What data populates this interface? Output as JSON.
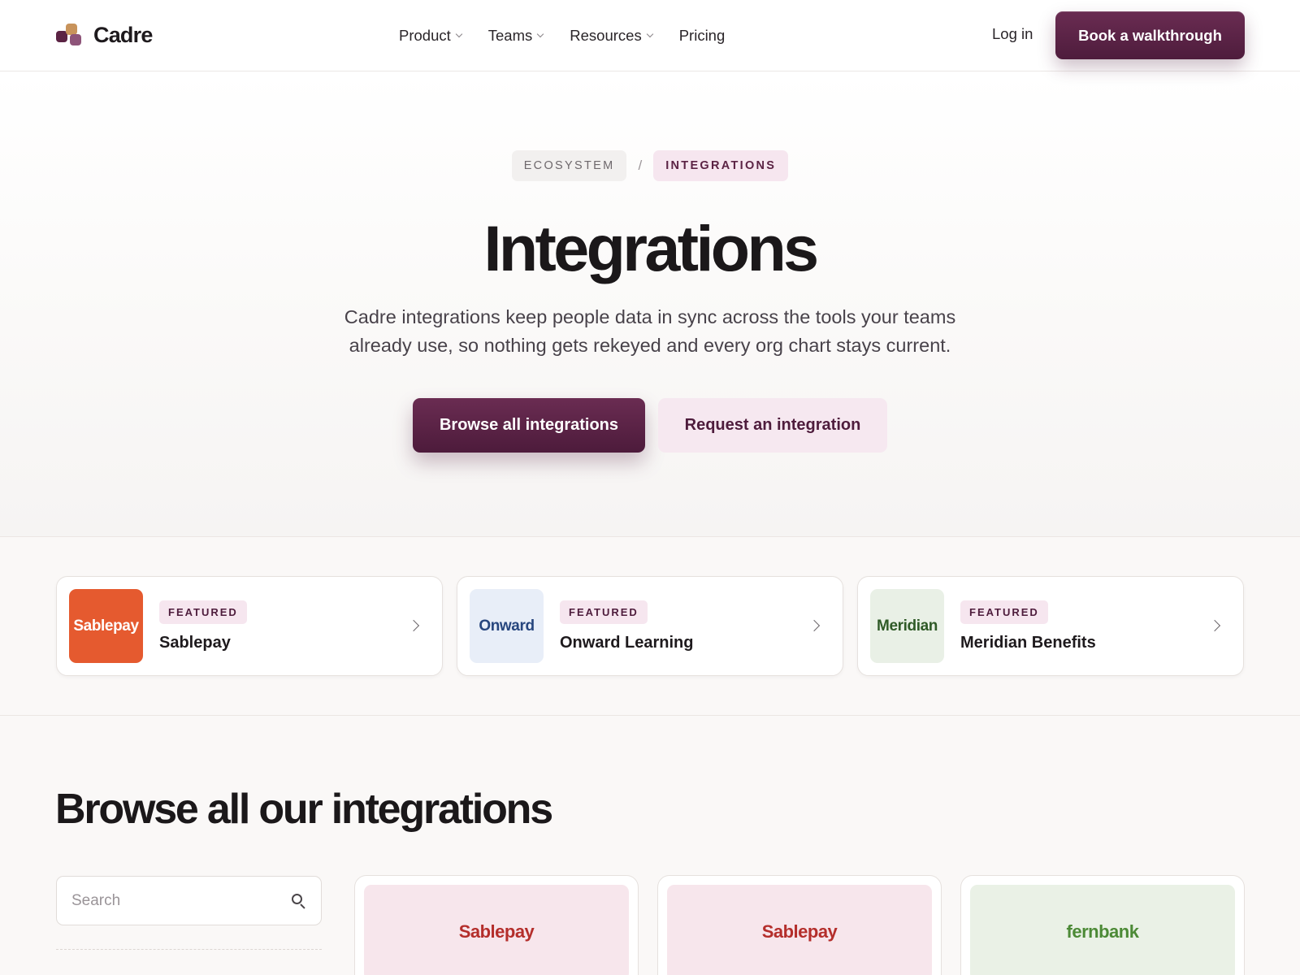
{
  "header": {
    "brand": "Cadre",
    "nav": [
      {
        "label": "Product",
        "has_dropdown": true
      },
      {
        "label": "Teams",
        "has_dropdown": true
      },
      {
        "label": "Resources",
        "has_dropdown": true
      },
      {
        "label": "Pricing",
        "has_dropdown": false
      }
    ],
    "login_label": "Log in",
    "cta_label": "Book a walkthrough"
  },
  "hero": {
    "breadcrumb": [
      "ECOSYSTEM",
      "INTEGRATIONS"
    ],
    "breadcrumb_separator": "/",
    "title": "Integrations",
    "subtitle": "Cadre integrations keep people data in sync across the tools your teams already use, so nothing gets rekeyed and every org chart stays current.",
    "primary_cta": "Browse all integrations",
    "secondary_cta": "Request an integration"
  },
  "featured": [
    {
      "logo_text": "Sablepay",
      "badge": "FEATURED",
      "name": "Sablepay",
      "logo_bg": "#e55a2f",
      "logo_color": "#ffffff"
    },
    {
      "logo_text": "Onward",
      "badge": "FEATURED",
      "name": "Onward Learning",
      "logo_bg": "#e8eef8",
      "logo_color": "#27467e"
    },
    {
      "logo_text": "Meridian",
      "badge": "FEATURED",
      "name": "Meridian Benefits",
      "logo_bg": "#e9f0e6",
      "logo_color": "#2f5a27"
    }
  ],
  "browse": {
    "title": "Browse all our integrations",
    "search_placeholder": "Search",
    "cards": [
      {
        "logo_text": "Sablepay",
        "logo_bg": "#f7e6ec",
        "logo_color": "#b42e2b"
      },
      {
        "logo_text": "Sablepay",
        "logo_bg": "#f7e6ec",
        "logo_color": "#b42e2b"
      },
      {
        "logo_text": "fernbank",
        "logo_bg": "#eaf1e6",
        "logo_color": "#4c8a36"
      }
    ]
  },
  "colors": {
    "accent": "#5b2344",
    "accent_light": "#f6e6ef"
  }
}
